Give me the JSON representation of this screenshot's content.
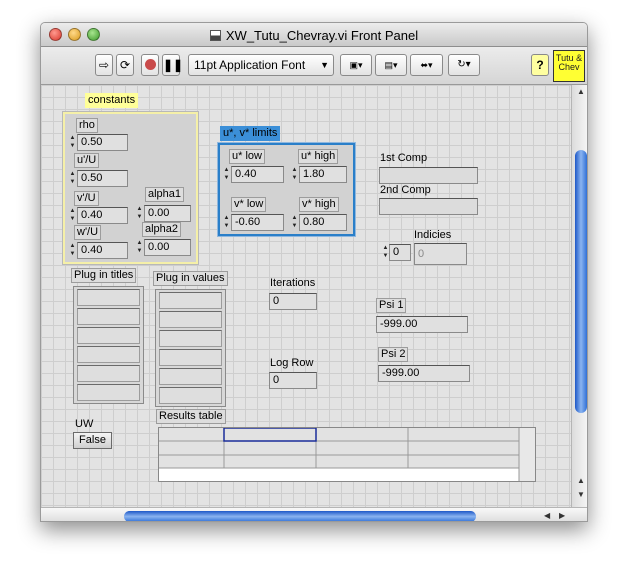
{
  "window": {
    "title": "XW_Tutu_Chevray.vi Front Panel"
  },
  "toolbar": {
    "font": "11pt Application Font",
    "help": "?",
    "icon_text": "Tutu & Chev"
  },
  "constants": {
    "title": "constants",
    "rho": {
      "label": "rho",
      "value": "0.50"
    },
    "uU": {
      "label": "u'/U",
      "value": "0.50"
    },
    "vU": {
      "label": "v'/U",
      "value": "0.40"
    },
    "wU": {
      "label": "w'/U",
      "value": "0.40"
    },
    "alpha1": {
      "label": "alpha1",
      "value": "0.00"
    },
    "alpha2": {
      "label": "alpha2",
      "value": "0.00"
    }
  },
  "limits": {
    "title": "u*, v* limits",
    "u_low": {
      "label": "u* low",
      "value": "0.40"
    },
    "u_high": {
      "label": "u* high",
      "value": "1.80"
    },
    "v_low": {
      "label": "v* low",
      "value": "-0.60"
    },
    "v_high": {
      "label": "v* high",
      "value": "0.80"
    }
  },
  "comps": {
    "first": "1st Comp",
    "second": "2nd Comp"
  },
  "indicies": {
    "label": "Indicies",
    "index": "0",
    "value": "0"
  },
  "plug_titles": {
    "label": "Plug in titles"
  },
  "plug_values": {
    "label": "Plug in values"
  },
  "iterations": {
    "label": "Iterations",
    "value": "0"
  },
  "log_row": {
    "label": "Log Row",
    "value": "0"
  },
  "psi1": {
    "label": "Psi 1",
    "value": "-999.00"
  },
  "psi2": {
    "label": "Psi 2",
    "value": "-999.00"
  },
  "uw": {
    "label": "UW",
    "value": "False"
  },
  "results": {
    "label": "Results table"
  },
  "colors": {
    "cluster_yellow": "#f5f0a8",
    "cluster_blue": "#2a7fc9",
    "scroll_blue": "#2f6fd6"
  }
}
